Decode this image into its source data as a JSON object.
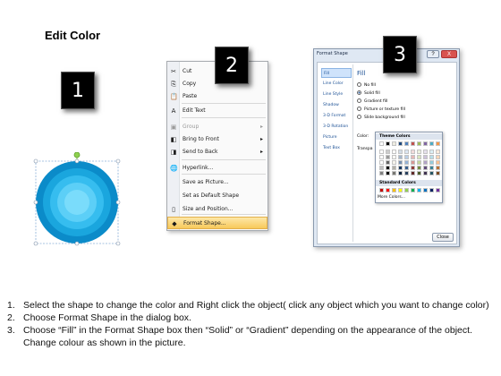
{
  "title": "Edit Color",
  "step_badges": [
    "1",
    "2",
    "3"
  ],
  "context_menu": {
    "items": [
      {
        "label": "Cut",
        "icon": "scissors-icon",
        "glyph": "✂",
        "disabled": false,
        "submenu": false
      },
      {
        "label": "Copy",
        "icon": "copy-icon",
        "glyph": "⎘",
        "disabled": false,
        "submenu": false
      },
      {
        "label": "Paste",
        "icon": "paste-icon",
        "glyph": "📋",
        "disabled": false,
        "submenu": false
      },
      {
        "label": "Edit Text",
        "icon": "edit-text-icon",
        "glyph": "A",
        "disabled": false,
        "submenu": false
      },
      {
        "label": "Group",
        "icon": "group-icon",
        "glyph": "▣",
        "disabled": true,
        "submenu": true
      },
      {
        "label": "Bring to Front",
        "icon": "bring-front-icon",
        "glyph": "◧",
        "disabled": false,
        "submenu": true
      },
      {
        "label": "Send to Back",
        "icon": "send-back-icon",
        "glyph": "◨",
        "disabled": false,
        "submenu": true
      },
      {
        "label": "Hyperlink...",
        "icon": "hyperlink-icon",
        "glyph": "🌐",
        "disabled": false,
        "submenu": false
      },
      {
        "label": "Save as Picture...",
        "icon": "",
        "glyph": "",
        "disabled": false,
        "submenu": false
      },
      {
        "label": "Set as Default Shape",
        "icon": "",
        "glyph": "",
        "disabled": false,
        "submenu": false
      },
      {
        "label": "Size and Position...",
        "icon": "size-icon",
        "glyph": "▯",
        "disabled": false,
        "submenu": false
      },
      {
        "label": "Format Shape...",
        "icon": "format-shape-icon",
        "glyph": "◆",
        "disabled": false,
        "submenu": false,
        "highlighted": true
      }
    ]
  },
  "dialog": {
    "title": "Format Shape",
    "help_label": "?",
    "close_label": "X",
    "nav": [
      "Fill",
      "Line Color",
      "Line Style",
      "Shadow",
      "3-D Format",
      "3-D Rotation",
      "Picture",
      "Text Box"
    ],
    "selected_nav": "Fill",
    "fill_heading": "Fill",
    "fill_options": [
      "No fill",
      "Solid fill",
      "Gradient fill",
      "Picture or texture fill",
      "Slide background fill"
    ],
    "selected_fill": "Solid fill",
    "color_label": "Color:",
    "transparency_label": "Transpa",
    "close_button": "Close"
  },
  "palette": {
    "theme_heading": "Theme Colors",
    "standard_heading": "Standard Colors",
    "more_colors": "More Colors...",
    "theme_top": [
      "#ffffff",
      "#000000",
      "#eeece1",
      "#1f497d",
      "#4f81bd",
      "#c0504d",
      "#9bbb59",
      "#8064a2",
      "#4bacc6",
      "#f79646"
    ],
    "standard": [
      "#c00000",
      "#ff0000",
      "#ffc000",
      "#ffff00",
      "#92d050",
      "#00b050",
      "#00b0f0",
      "#0070c0",
      "#002060",
      "#7030a0"
    ]
  },
  "instructions": [
    {
      "num": "1.",
      "text": "Select the shape to change the color and Right click the object( click any object which you want to change color)"
    },
    {
      "num": "2.",
      "text": "Choose Format Shape in the dialog box."
    },
    {
      "num": "3.",
      "text": "Choose “Fill” in the Format Shape box then “Solid” or “Gradient” depending on the appearance of the object. Change colour as shown in the picture."
    }
  ]
}
